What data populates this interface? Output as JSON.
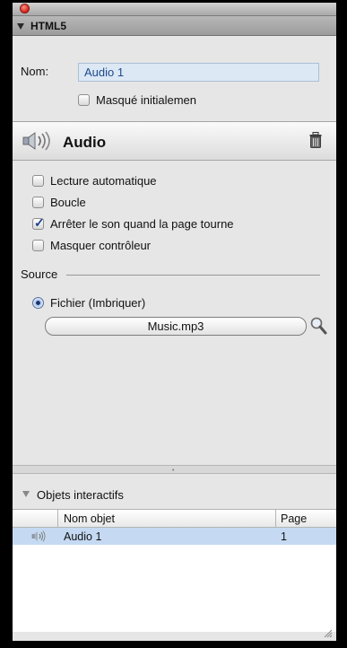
{
  "panel": {
    "header": "HTML5"
  },
  "name_field": {
    "label": "Nom:",
    "value": "Audio 1"
  },
  "hidden_checkbox": {
    "label": "Masqué initialemen",
    "checked": false
  },
  "audio_section": {
    "title": "Audio",
    "icon": "speaker-icon"
  },
  "options": [
    {
      "label": "Lecture automatique",
      "checked": false
    },
    {
      "label": "Boucle",
      "checked": false
    },
    {
      "label": "Arrêter le son quand la page tourne",
      "checked": true
    },
    {
      "label": "Masquer contrôleur",
      "checked": false
    }
  ],
  "source": {
    "label": "Source",
    "radio_label": "Fichier (Imbriquer)",
    "file_value": "Music.mp3"
  },
  "interactive_objects": {
    "header": "Objets interactifs",
    "columns": [
      "Nom objet",
      "Page"
    ],
    "rows": [
      {
        "icon": "speaker-icon",
        "name": "Audio 1",
        "page": "1"
      }
    ]
  },
  "colors": {
    "selection_row": "#c5daf2",
    "input_bg": "#dde8f5",
    "close_button": "#d02217"
  }
}
